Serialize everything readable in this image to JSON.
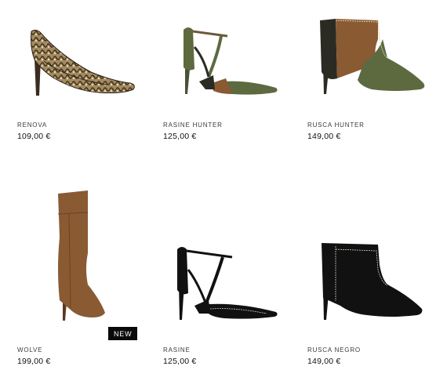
{
  "products": [
    {
      "name": "RENOVA",
      "price": "109,00 €",
      "icon": "snake-print-pump-icon"
    },
    {
      "name": "RASINE HUNTER",
      "price": "125,00 €",
      "icon": "green-tstrap-heel-icon"
    },
    {
      "name": "RUSCA HUNTER",
      "price": "149,00 €",
      "icon": "green-brown-ankle-boot-icon"
    },
    {
      "name": "WOLVE",
      "price": "199,00 €",
      "icon": "brown-over-knee-boot-icon",
      "badge": "NEW"
    },
    {
      "name": "RASINE",
      "price": "125,00 €",
      "icon": "black-tstrap-heel-icon"
    },
    {
      "name": "RUSCA NEGRO",
      "price": "149,00 €",
      "icon": "black-ankle-boot-icon"
    }
  ],
  "colors": {
    "text": "#222222",
    "badge_bg": "#0a0a0a",
    "olive": "#5d6a40",
    "tan": "#8a5a33",
    "black_suede": "#111111"
  }
}
